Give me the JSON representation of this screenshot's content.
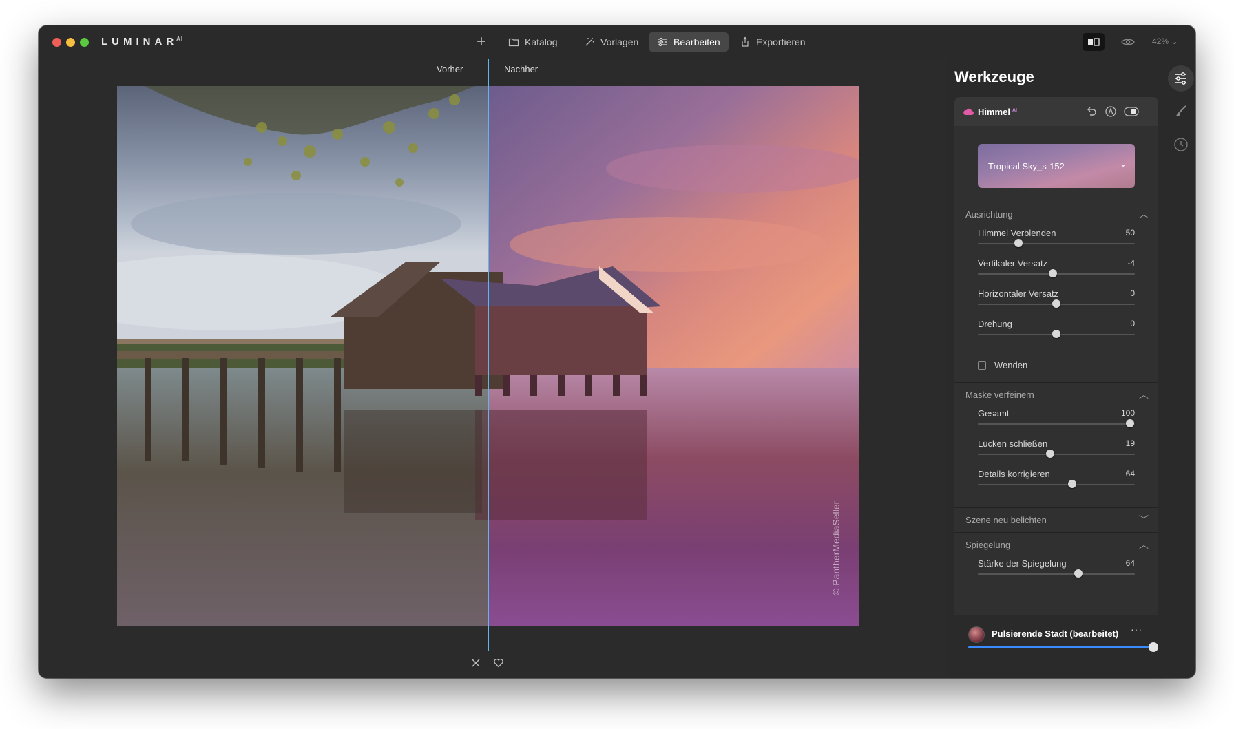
{
  "app": {
    "logo_text": "LUMINAR",
    "logo_sup": "AI",
    "colors": {
      "close": "#ed5f57",
      "minimize": "#f5be3e",
      "maximize": "#5bc93f",
      "accent": "#3a8bff",
      "splitter": "#5fb7ee"
    }
  },
  "toolbar": {
    "add_icon": "plus-icon",
    "nav": [
      {
        "label": "Katalog",
        "icon": "folder-icon",
        "active": false
      },
      {
        "label": "Vorlagen",
        "icon": "magic-wand-icon",
        "active": false
      },
      {
        "label": "Bearbeiten",
        "icon": "sliders-icon",
        "active": true
      },
      {
        "label": "Exportieren",
        "icon": "share-icon",
        "active": false
      }
    ],
    "zoom": "42%"
  },
  "canvas": {
    "before_label": "Vorher",
    "after_label": "Nachher",
    "watermark": "© PantherMediaSeller"
  },
  "panel": {
    "title": "Werkzeuge",
    "tool": {
      "name": "Himmel",
      "badge": "AI",
      "preset": "Tropical Sky_s-152"
    },
    "sections": {
      "ausrichtung": {
        "title": "Ausrichtung",
        "sliders": [
          {
            "label": "Himmel Verblenden",
            "value": "50",
            "fraction": 0.26
          },
          {
            "label": "Vertikaler Versatz",
            "value": "-4",
            "fraction": 0.48
          },
          {
            "label": "Horizontaler Versatz",
            "value": "0",
            "fraction": 0.5
          },
          {
            "label": "Drehung",
            "value": "0",
            "fraction": 0.5
          }
        ],
        "checkbox": {
          "label": "Wenden",
          "checked": false
        }
      },
      "maske": {
        "title": "Maske verfeinern",
        "sliders": [
          {
            "label": "Gesamt",
            "value": "100",
            "fraction": 0.97
          },
          {
            "label": "Lücken schließen",
            "value": "19",
            "fraction": 0.46
          },
          {
            "label": "Details korrigieren",
            "value": "64",
            "fraction": 0.6
          }
        ]
      },
      "szene": {
        "title": "Szene neu belichten"
      },
      "spiegelung": {
        "title": "Spiegelung",
        "sliders": [
          {
            "label": "Stärke der Spiegelung",
            "value": "64",
            "fraction": 0.64
          }
        ]
      }
    },
    "footer": {
      "preset_name": "Pulsierende Stadt (bearbeitet)",
      "more": "···",
      "amount": 1.0
    }
  }
}
